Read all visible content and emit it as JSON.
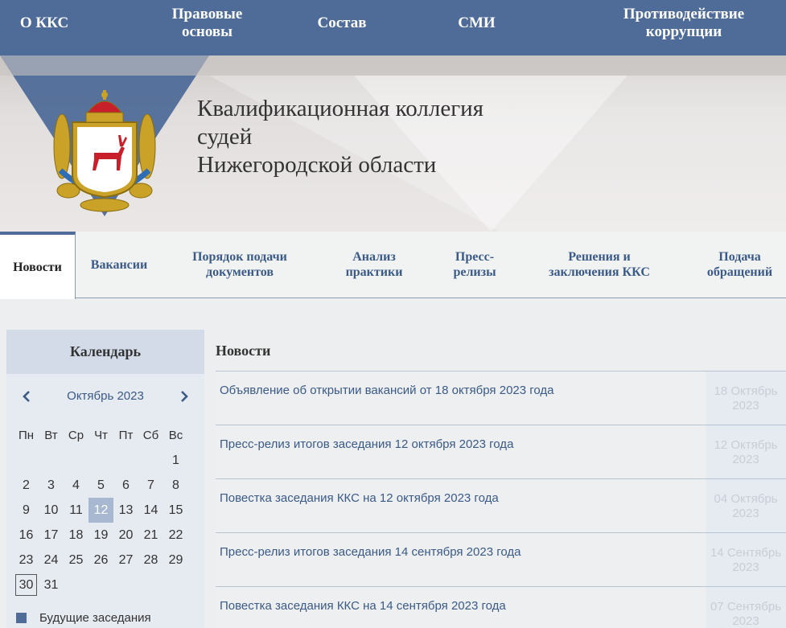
{
  "topnav": {
    "items": [
      {
        "line1": "О ККС",
        "line2": ""
      },
      {
        "line1": "Правовые",
        "line2": "основы"
      },
      {
        "line1": "Состав",
        "line2": ""
      },
      {
        "line1": "СМИ",
        "line2": ""
      },
      {
        "line1": "Противодействие",
        "line2": "коррупции"
      }
    ]
  },
  "header": {
    "title_line1": "Квалификационная коллегия",
    "title_line2": "судей",
    "title_line3": "Нижегородской области",
    "crest_icon": "coat-of-arms-nizhny-novgorod-icon"
  },
  "tabs": [
    {
      "line1": "Новости",
      "line2": ""
    },
    {
      "line1": "Вакансии",
      "line2": ""
    },
    {
      "line1": "Порядок подачи",
      "line2": "документов"
    },
    {
      "line1": "Анализ",
      "line2": "практики"
    },
    {
      "line1": "Пресс-",
      "line2": "релизы"
    },
    {
      "line1": "Решения и",
      "line2": "заключения ККС"
    },
    {
      "line1": "Подача",
      "line2": "обращений"
    }
  ],
  "calendar": {
    "title": "Календарь",
    "month": "Октябрь 2023",
    "weekdays": [
      "Пн",
      "Вт",
      "Ср",
      "Чт",
      "Пт",
      "Сб",
      "Вс"
    ],
    "weeks": [
      [
        "",
        "",
        "",
        "",
        "",
        "",
        "1"
      ],
      [
        "2",
        "3",
        "4",
        "5",
        "6",
        "7",
        "8"
      ],
      [
        "9",
        "10",
        "11",
        "12",
        "13",
        "14",
        "15"
      ],
      [
        "16",
        "17",
        "18",
        "19",
        "20",
        "21",
        "22"
      ],
      [
        "23",
        "24",
        "25",
        "26",
        "27",
        "28",
        "29"
      ],
      [
        "30",
        "31",
        "",
        "",
        "",
        "",
        ""
      ]
    ],
    "meeting_days": [
      "12"
    ],
    "today": "30",
    "legend_label": "Будущие заседания",
    "colors": {
      "meeting": "#a8b8d0",
      "legend": "#4f6c98"
    }
  },
  "news": {
    "title": "Новости",
    "items": [
      {
        "text": "Объявление об открытии вакансий от 18 октября 2023 года",
        "date_day": "18 Октябрь",
        "date_year": "2023"
      },
      {
        "text": "Пресс-релиз итогов заседания 12 октября 2023 года",
        "date_day": "12 Октябрь",
        "date_year": "2023"
      },
      {
        "text": "Повестка заседания ККС на 12 октября 2023 года",
        "date_day": "04 Октябрь",
        "date_year": "2023"
      },
      {
        "text": "Пресс-релиз итогов заседания 14 сентября 2023 года",
        "date_day": "14 Сентябрь",
        "date_year": "2023"
      },
      {
        "text": "Повестка заседания ККС на 14 сентября 2023 года",
        "date_day": "07 Сентябрь",
        "date_year": "2023"
      }
    ]
  },
  "colors": {
    "nav": "#4f6c98",
    "link": "#3b5a86"
  }
}
